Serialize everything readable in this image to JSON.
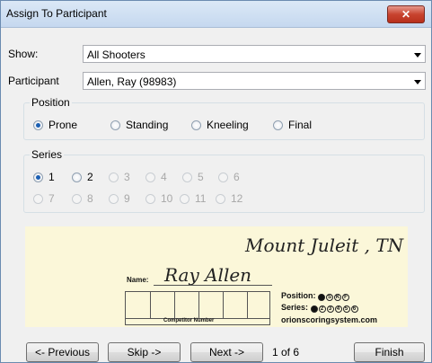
{
  "window": {
    "title": "Assign To Participant",
    "close_symbol": "✕"
  },
  "show": {
    "label": "Show:",
    "value": "All Shooters"
  },
  "participant": {
    "label": "Participant",
    "value": "Allen, Ray (98983)"
  },
  "position": {
    "legend": "Position",
    "options": [
      {
        "label": "Prone",
        "checked": true
      },
      {
        "label": "Standing",
        "checked": false
      },
      {
        "label": "Kneeling",
        "checked": false
      },
      {
        "label": "Final",
        "checked": false
      }
    ]
  },
  "series": {
    "legend": "Series",
    "options": [
      {
        "label": "1",
        "checked": true,
        "enabled": true
      },
      {
        "label": "2",
        "checked": false,
        "enabled": true
      },
      {
        "label": "3",
        "checked": false,
        "enabled": false
      },
      {
        "label": "4",
        "checked": false,
        "enabled": false
      },
      {
        "label": "5",
        "checked": false,
        "enabled": false
      },
      {
        "label": "6",
        "checked": false,
        "enabled": false
      },
      {
        "label": "7",
        "checked": false,
        "enabled": false
      },
      {
        "label": "8",
        "checked": false,
        "enabled": false
      },
      {
        "label": "9",
        "checked": false,
        "enabled": false
      },
      {
        "label": "10",
        "checked": false,
        "enabled": false
      },
      {
        "label": "11",
        "checked": false,
        "enabled": false
      },
      {
        "label": "12",
        "checked": false,
        "enabled": false
      }
    ]
  },
  "card": {
    "location": "Mount Juleit , TN",
    "name_label": "Name:",
    "name_value": "Ray Allen",
    "competitor_number_label": "Competitor Number",
    "position_label": "Position:",
    "position_letters": [
      "P",
      "S",
      "K",
      "F"
    ],
    "series_label": "Series:",
    "series_numbers": [
      "1",
      "2",
      "3",
      "4",
      "5",
      "6"
    ],
    "website": "orionscoringsystem.com"
  },
  "buttons": {
    "previous": "<- Previous",
    "skip": "Skip ->",
    "next": "Next ->",
    "finish": "Finish"
  },
  "counter": "1 of 6"
}
